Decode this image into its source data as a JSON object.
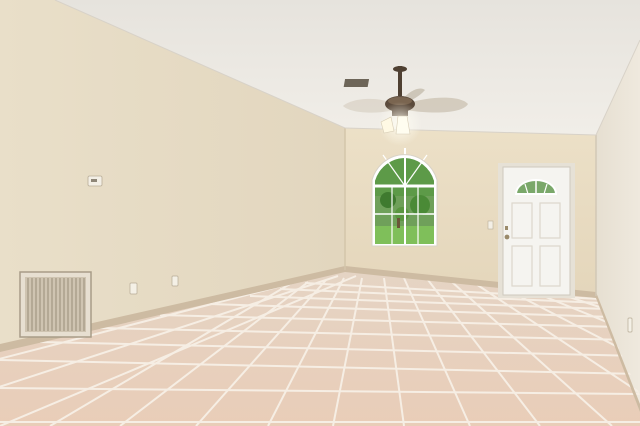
{
  "scene": {
    "description_label": "",
    "colors": {
      "ceiling": "#ece9e3",
      "left_wall": "#e6dcc6",
      "back_wall": "#e9dcc2",
      "right_wall": "#ece6da",
      "floor_tile": "#e8d2c0",
      "grout": "#f5ece2",
      "baseboard": "#cbb9a1",
      "door": "#f3f2ee",
      "window_frame": "#ffffff",
      "greenery": "#4f8a3a",
      "fan_body": "#5b4a3b",
      "light": "#fff6dc",
      "vent": "#d7cdbd"
    }
  }
}
